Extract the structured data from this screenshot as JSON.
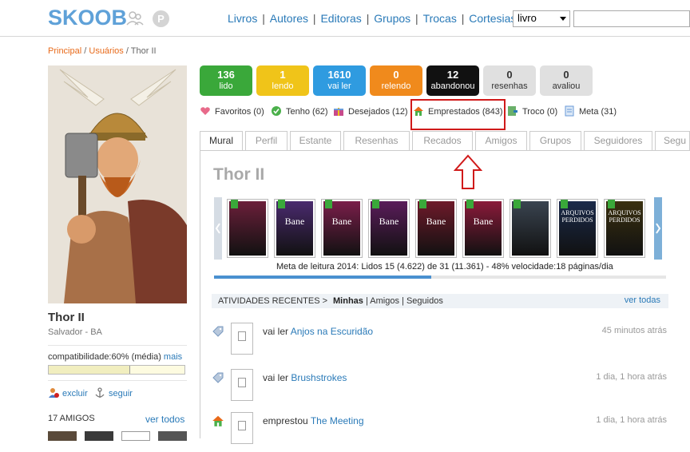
{
  "header": {
    "logo": "SKOOB",
    "badge": "P",
    "nav": [
      "Livros",
      "Autores",
      "Editoras",
      "Grupos",
      "Trocas",
      "Cortesias"
    ],
    "search_select": "livro"
  },
  "breadcrumb": {
    "home": "Principal",
    "users": "Usuários",
    "current": "Thor II",
    "sep": "/"
  },
  "profile": {
    "name": "Thor II",
    "location": "Salvador - BA",
    "compat_label": "compatibilidade:60% (média)",
    "compat_more": "mais",
    "compat_value": 0.6,
    "exclude": "excluir",
    "follow": "seguir",
    "friends_title": "17 AMIGOS",
    "friends_all": "ver todos"
  },
  "stats": [
    {
      "num": "136",
      "label": "lido",
      "color": "#3aa83a"
    },
    {
      "num": "1",
      "label": "lendo",
      "color": "#f0c419"
    },
    {
      "num": "1610",
      "label": "vai ler",
      "color": "#2f9be0"
    },
    {
      "num": "0",
      "label": "relendo",
      "color": "#f08a1c"
    },
    {
      "num": "12",
      "label": "abandonou",
      "color": "#111111"
    },
    {
      "num": "0",
      "label": "resenhas",
      "color": "#e0e0e0"
    },
    {
      "num": "0",
      "label": "avaliou",
      "color": "#e0e0e0"
    }
  ],
  "shelves": [
    {
      "label": "Favoritos (0)",
      "icon": "heart-icon"
    },
    {
      "label": "Tenho (62)",
      "icon": "check-icon"
    },
    {
      "label": "Desejados (12)",
      "icon": "gift-icon"
    },
    {
      "label": "Emprestados (843)",
      "icon": "house-icon"
    },
    {
      "label": "Troco (0)",
      "icon": "exchange-icon"
    },
    {
      "label": "Meta (31)",
      "icon": "doc-icon"
    }
  ],
  "tabs": [
    "Mural",
    "Perfil",
    "Estante",
    "Resenhas",
    "Recados",
    "Amigos",
    "Grupos",
    "Seguidores",
    "Segu"
  ],
  "mural_title": "Thor II",
  "books": [
    {
      "title": "",
      "color": "#6b1f3a"
    },
    {
      "title": "Bane",
      "color": "#4a2a6e"
    },
    {
      "title": "Bane",
      "color": "#7a1e4a"
    },
    {
      "title": "Bane",
      "color": "#5a1c5a"
    },
    {
      "title": "Bane",
      "color": "#6e1a2a"
    },
    {
      "title": "Bane",
      "color": "#8a1a3a"
    },
    {
      "title": "",
      "color": "#3a4450"
    },
    {
      "title": "ARQUIVOS PERDIDOS",
      "color": "#1a2a4a"
    },
    {
      "title": "ARQUIVOS PERDIDOS",
      "color": "#3a3010"
    }
  ],
  "meta_text": "Meta de leitura 2014: Lidos 15 (4.622) de 31 (11.361) - 48% velocidade:18 páginas/dia",
  "meta_progress": 0.48,
  "activities_header": {
    "title": "ATIVIDADES RECENTES >",
    "mine": "Minhas",
    "friends": "Amigos",
    "followed": "Seguidos",
    "all": "ver todas"
  },
  "activities": [
    {
      "verb": "vai ler",
      "book": "Anjos na Escuridão",
      "time": "45 minutos atrás",
      "icon": "tag-icon"
    },
    {
      "verb": "vai ler",
      "book": "Brushstrokes",
      "time": "1 dia, 1 hora atrás",
      "icon": "tag-icon"
    },
    {
      "verb": "emprestou",
      "book": "The Meeting",
      "time": "1 dia, 1 hora atrás",
      "icon": "house-icon"
    }
  ]
}
